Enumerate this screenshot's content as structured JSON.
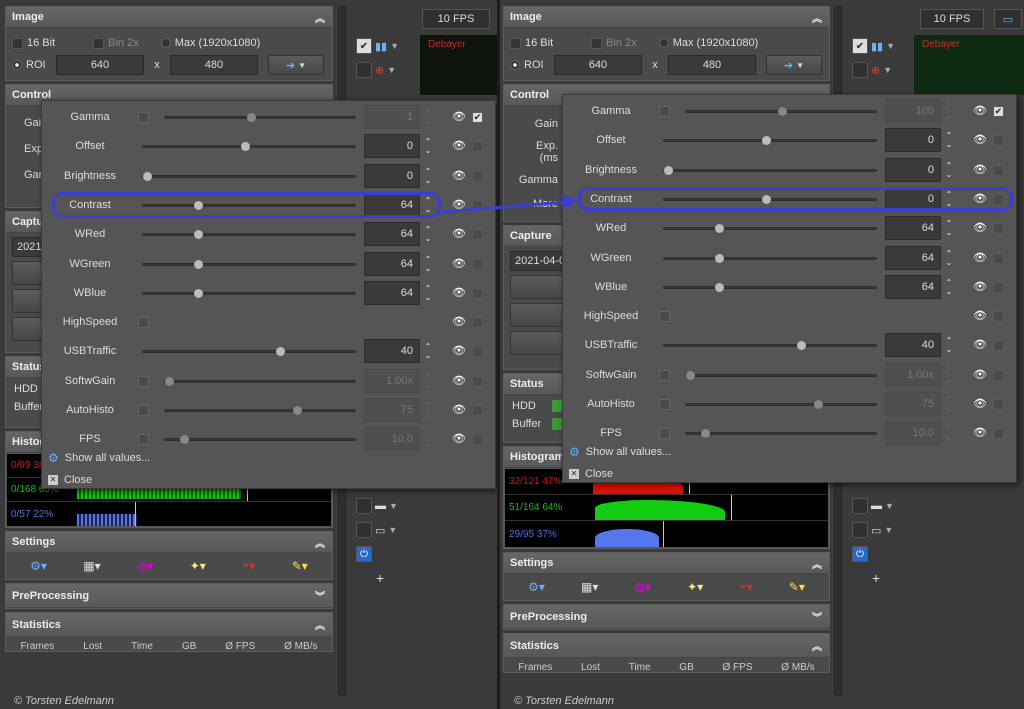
{
  "colors": {
    "highlight": "#3a3fd0",
    "red_hist": "#e01010",
    "green_hist": "#10c010",
    "blue_hist": "#5070e0",
    "debayer": "#e02020"
  },
  "image_panel": {
    "title": "Image",
    "bit16": "16 Bit",
    "bin2x": "Bin 2x",
    "max": "Max (1920x1080)",
    "roi": "ROI",
    "x": "x",
    "roi_w": "640",
    "roi_h": "480"
  },
  "fps": "10 FPS",
  "debayer": "Debayer",
  "control_panel": {
    "title": "Control",
    "gain": "Gain",
    "exp": "Exp. (ms",
    "gamma": "Gamma",
    "more": "More"
  },
  "capture_panel": {
    "title": "Capture",
    "date": "2021-04-0"
  },
  "status_panel": {
    "title": "Status",
    "hdd": "HDD",
    "buffer": "Buffer"
  },
  "histogram": {
    "title": "Histogram",
    "left": {
      "red": "0/99 38%",
      "green": "0/168 65%",
      "blue": "0/57 22%"
    },
    "right": {
      "red": "32/121 47%",
      "green": "51/164 64%",
      "blue": "29/95 37%"
    }
  },
  "settings_panel": {
    "title": "Settings"
  },
  "preprocessing_panel": {
    "title": "PreProcessing"
  },
  "statistics_panel": {
    "title": "Statistics",
    "cols": [
      "Frames",
      "Lost",
      "Time",
      "GB",
      "Ø FPS",
      "Ø MB/s"
    ]
  },
  "credit": "© Torsten Edelmann",
  "popup_left": {
    "rows": [
      {
        "label": "Gamma",
        "value": "1",
        "pos": 0.45,
        "enabled": false
      },
      {
        "label": "Offset",
        "value": "0",
        "pos": 0.48,
        "enabled": true
      },
      {
        "label": "Brightness",
        "value": "0",
        "pos": 0.0,
        "enabled": true
      },
      {
        "label": "Contrast",
        "value": "64",
        "pos": 0.25,
        "enabled": true
      },
      {
        "label": "WRed",
        "value": "64",
        "pos": 0.25,
        "enabled": true
      },
      {
        "label": "WGreen",
        "value": "64",
        "pos": 0.25,
        "enabled": true
      },
      {
        "label": "WBlue",
        "value": "64",
        "pos": 0.25,
        "enabled": true
      },
      {
        "label": "HighSpeed",
        "value": "",
        "pos": null,
        "enabled": true
      },
      {
        "label": "USBTraffic",
        "value": "40",
        "pos": 0.65,
        "enabled": true
      },
      {
        "label": "SoftwGain",
        "value": "1.00x",
        "pos": 0.0,
        "enabled": false
      },
      {
        "label": "AutoHisto",
        "value": "75",
        "pos": 0.7,
        "enabled": false
      },
      {
        "label": "FPS",
        "value": "10.0",
        "pos": 0.08,
        "enabled": false
      }
    ],
    "show_all": "Show all values...",
    "close": "Close"
  },
  "popup_right": {
    "rows": [
      {
        "label": "Gamma",
        "value": "100",
        "pos": 0.5,
        "enabled": false
      },
      {
        "label": "Offset",
        "value": "0",
        "pos": 0.48,
        "enabled": true
      },
      {
        "label": "Brightness",
        "value": "0",
        "pos": 0.0,
        "enabled": true
      },
      {
        "label": "Contrast",
        "value": "0",
        "pos": 0.48,
        "enabled": true
      },
      {
        "label": "WRed",
        "value": "64",
        "pos": 0.25,
        "enabled": true
      },
      {
        "label": "WGreen",
        "value": "64",
        "pos": 0.25,
        "enabled": true
      },
      {
        "label": "WBlue",
        "value": "64",
        "pos": 0.25,
        "enabled": true
      },
      {
        "label": "HighSpeed",
        "value": "",
        "pos": null,
        "enabled": true
      },
      {
        "label": "USBTraffic",
        "value": "40",
        "pos": 0.65,
        "enabled": true
      },
      {
        "label": "SoftwGain",
        "value": "1.00x",
        "pos": 0.0,
        "enabled": false
      },
      {
        "label": "AutoHisto",
        "value": "75",
        "pos": 0.7,
        "enabled": false
      },
      {
        "label": "FPS",
        "value": "10.0",
        "pos": 0.08,
        "enabled": false
      }
    ],
    "show_all": "Show all values...",
    "close": "Close"
  }
}
